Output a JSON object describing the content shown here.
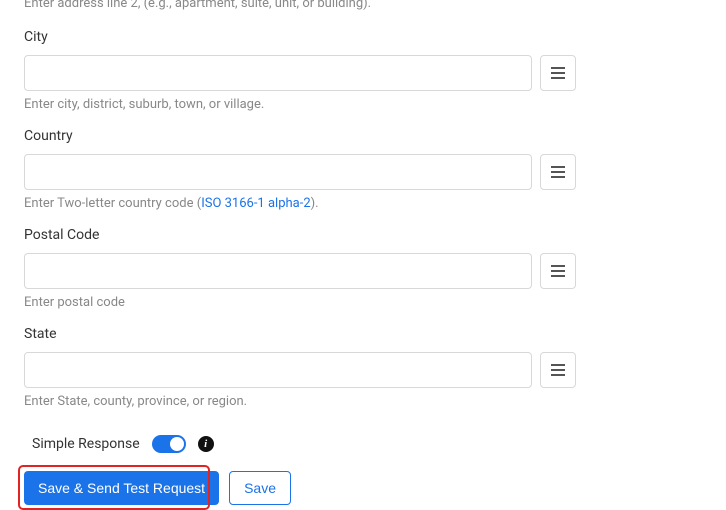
{
  "top_hint": "Enter address line 2, (e.g., apartment, suite, unit, or building).",
  "fields": {
    "city": {
      "label": "City",
      "value": "",
      "hint": "Enter city, district, suburb, town, or village."
    },
    "country": {
      "label": "Country",
      "value": "",
      "hint_prefix": "Enter Two-letter country code (",
      "hint_link": "ISO 3166-1 alpha-2",
      "hint_suffix": ")."
    },
    "postal_code": {
      "label": "Postal Code",
      "value": "",
      "hint": "Enter postal code"
    },
    "state": {
      "label": "State",
      "value": "",
      "hint": "Enter State, county, province, or region."
    }
  },
  "simple_response": {
    "label": "Simple Response",
    "enabled": true
  },
  "buttons": {
    "primary": "Save & Send Test Request",
    "secondary": "Save"
  }
}
